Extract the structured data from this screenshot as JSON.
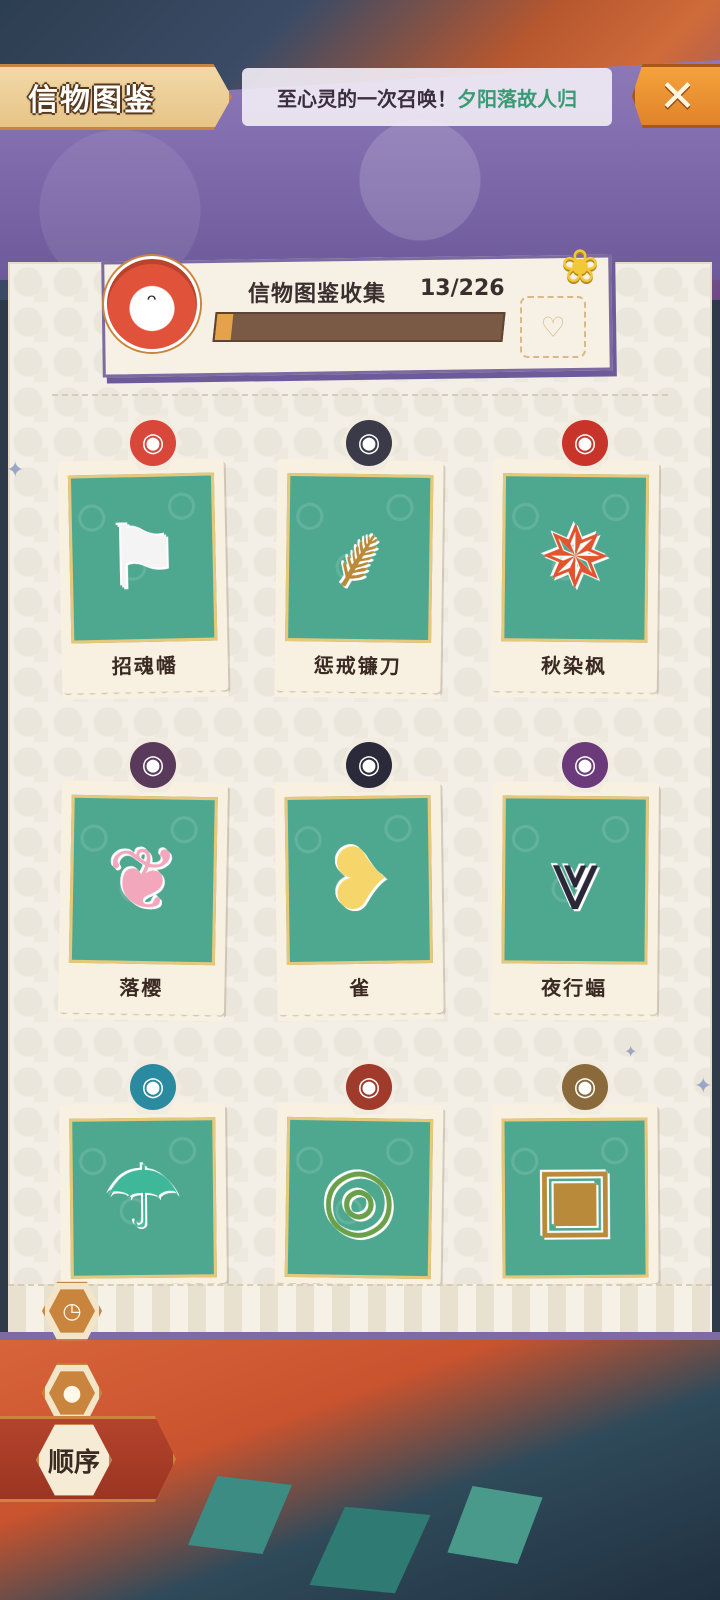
{
  "header": {
    "title": "信物图鉴",
    "marquee_prefix": "至心灵的一次召唤！",
    "marquee_highlight": "夕阳落故人归",
    "close_label": "✕"
  },
  "collection": {
    "label": "信物图鉴收集",
    "count": "13/226",
    "progress_fraction": 0.0575
  },
  "items": [
    {
      "name": "招魂幡",
      "glyph": "⚑",
      "art_color": "#f4f4f4",
      "avatar_color": "#d9463a",
      "avatar_glyph": "◉"
    },
    {
      "name": "惩戒镰刀",
      "glyph": "⸙",
      "art_color": "#b88a3a",
      "avatar_color": "#3a3a48",
      "avatar_glyph": "◉"
    },
    {
      "name": "秋染枫",
      "glyph": "✵",
      "art_color": "#e0542e",
      "avatar_color": "#c9342a",
      "avatar_glyph": "◉"
    },
    {
      "name": "落樱",
      "glyph": "❦",
      "art_color": "#f2a7bd",
      "avatar_color": "#5a3a5a",
      "avatar_glyph": "◉"
    },
    {
      "name": "雀",
      "glyph": "❥",
      "art_color": "#f6d66a",
      "avatar_color": "#2a2a3a",
      "avatar_glyph": "◉"
    },
    {
      "name": "夜行蝠",
      "glyph": "⩔",
      "art_color": "#2a2838",
      "avatar_color": "#6a3a7a",
      "avatar_glyph": "◉"
    },
    {
      "name": "",
      "glyph": "☂",
      "art_color": "#3fb89a",
      "avatar_color": "#2a8aa0",
      "avatar_glyph": "◉"
    },
    {
      "name": "",
      "glyph": "◎",
      "art_color": "#6aa04a",
      "avatar_color": "#a03a2a",
      "avatar_glyph": "◉"
    },
    {
      "name": "",
      "glyph": "▣",
      "art_color": "#b88a3a",
      "avatar_color": "#8a6a3a",
      "avatar_glyph": "◉"
    }
  ],
  "controls": {
    "clock_icon": "clock-icon",
    "seed_icon": "seed-icon",
    "order_label": "顺序"
  },
  "colors": {
    "accent_orange": "#e0842a",
    "card_teal": "#4ea890",
    "purple": "#7b66a8"
  }
}
